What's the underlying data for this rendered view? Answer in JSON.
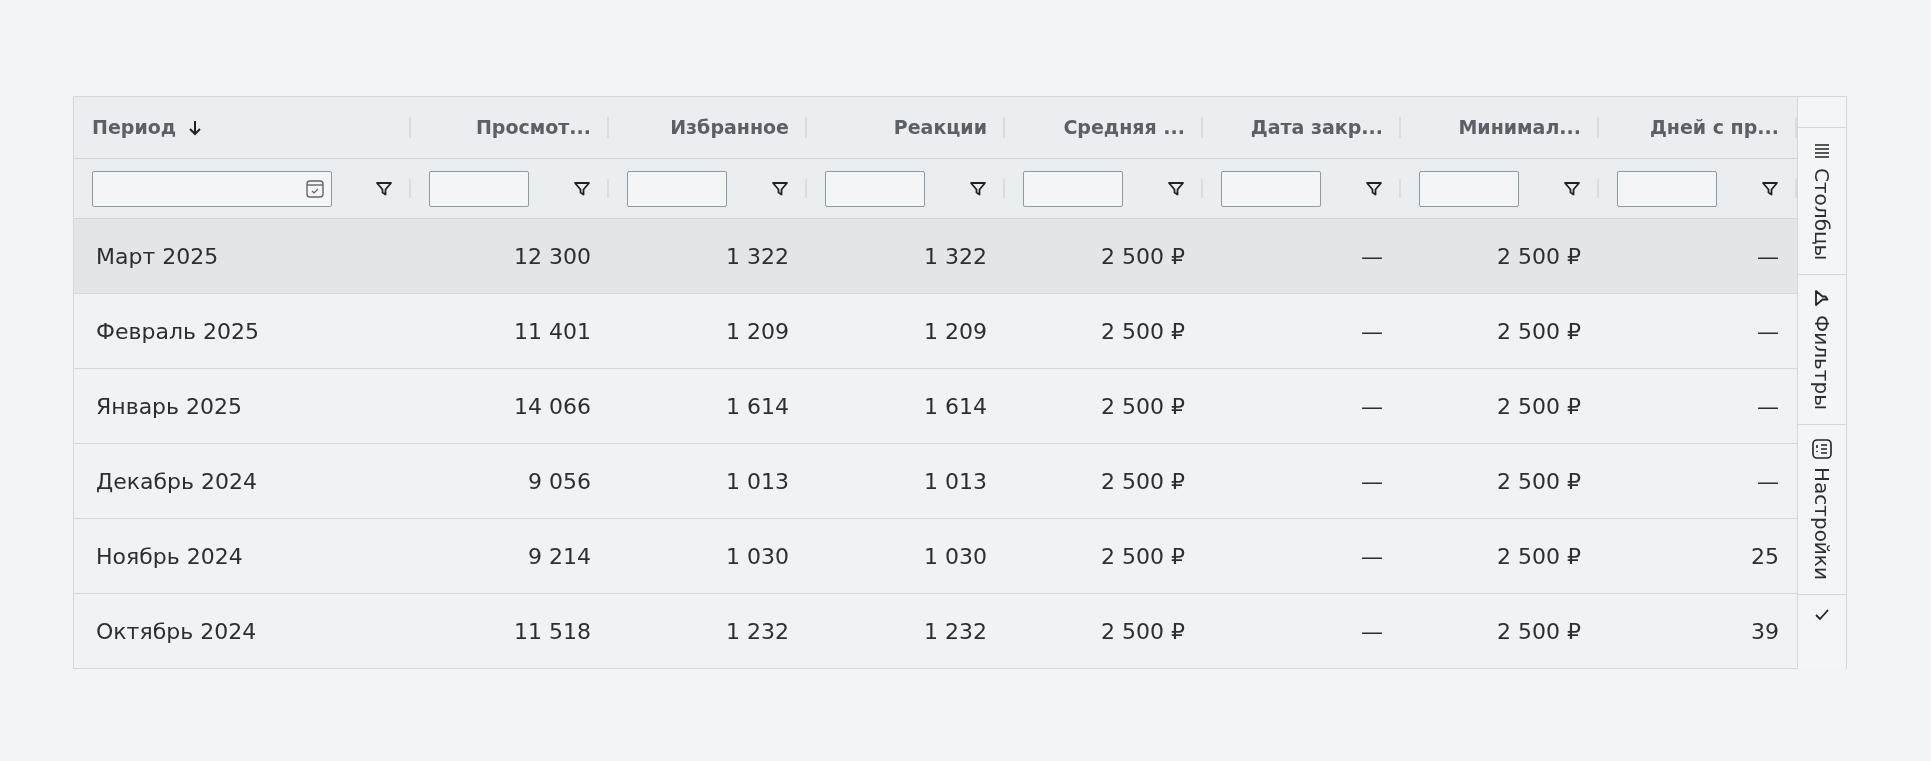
{
  "columns": [
    {
      "label": "Период",
      "sorted": true,
      "kind": "date"
    },
    {
      "label": "Просмот...",
      "sorted": false,
      "kind": "number"
    },
    {
      "label": "Избранное",
      "sorted": false,
      "kind": "number"
    },
    {
      "label": "Реакции",
      "sorted": false,
      "kind": "number"
    },
    {
      "label": "Средняя ...",
      "sorted": false,
      "kind": "number"
    },
    {
      "label": "Дата закр...",
      "sorted": false,
      "kind": "number"
    },
    {
      "label": "Минимал...",
      "sorted": false,
      "kind": "number"
    },
    {
      "label": "Дней с пр...",
      "sorted": false,
      "kind": "number"
    }
  ],
  "rows": [
    {
      "selected": true,
      "cells": [
        "Март 2025",
        "12 300",
        "1 322",
        "1 322",
        "2 500 ₽",
        "—",
        "2 500 ₽",
        "—"
      ]
    },
    {
      "selected": false,
      "cells": [
        "Февраль 2025",
        "11 401",
        "1 209",
        "1 209",
        "2 500 ₽",
        "—",
        "2 500 ₽",
        "—"
      ]
    },
    {
      "selected": false,
      "cells": [
        "Январь 2025",
        "14 066",
        "1 614",
        "1 614",
        "2 500 ₽",
        "—",
        "2 500 ₽",
        "—"
      ]
    },
    {
      "selected": false,
      "cells": [
        "Декабрь 2024",
        "9 056",
        "1 013",
        "1 013",
        "2 500 ₽",
        "—",
        "2 500 ₽",
        "—"
      ]
    },
    {
      "selected": false,
      "cells": [
        "Ноябрь 2024",
        "9 214",
        "1 030",
        "1 030",
        "2 500 ₽",
        "—",
        "2 500 ₽",
        "25"
      ]
    },
    {
      "selected": false,
      "cells": [
        "Октябрь 2024",
        "11 518",
        "1 232",
        "1 232",
        "2 500 ₽",
        "—",
        "2 500 ₽",
        "39"
      ]
    }
  ],
  "side_panel": [
    {
      "kind": "columns",
      "label": "Столбцы"
    },
    {
      "kind": "filters",
      "label": "Фильтры"
    },
    {
      "kind": "settings",
      "label": "Настройки"
    }
  ]
}
